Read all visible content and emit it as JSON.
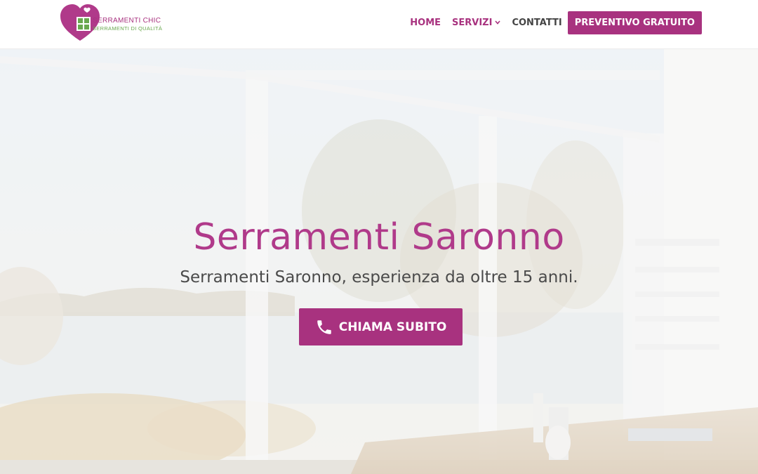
{
  "logo": {
    "line1": "Serramenti Chic",
    "line2": "Serramenti di Qualità"
  },
  "nav": {
    "home": "HOME",
    "servizi": "SERVIZI",
    "contatti": "CONTATTI",
    "cta": "PREVENTIVO GRATUITO"
  },
  "hero": {
    "title": "Serramenti Saronno",
    "subtitle": "Serramenti Saronno, esperienza da oltre 15 anni.",
    "button_label": "CHIAMA SUBITO",
    "button_icon": "phone-icon"
  },
  "colors": {
    "brand": "#a8327f",
    "title": "#b03a8a",
    "logo_green": "#6aa84f",
    "text_dark": "#444444"
  }
}
